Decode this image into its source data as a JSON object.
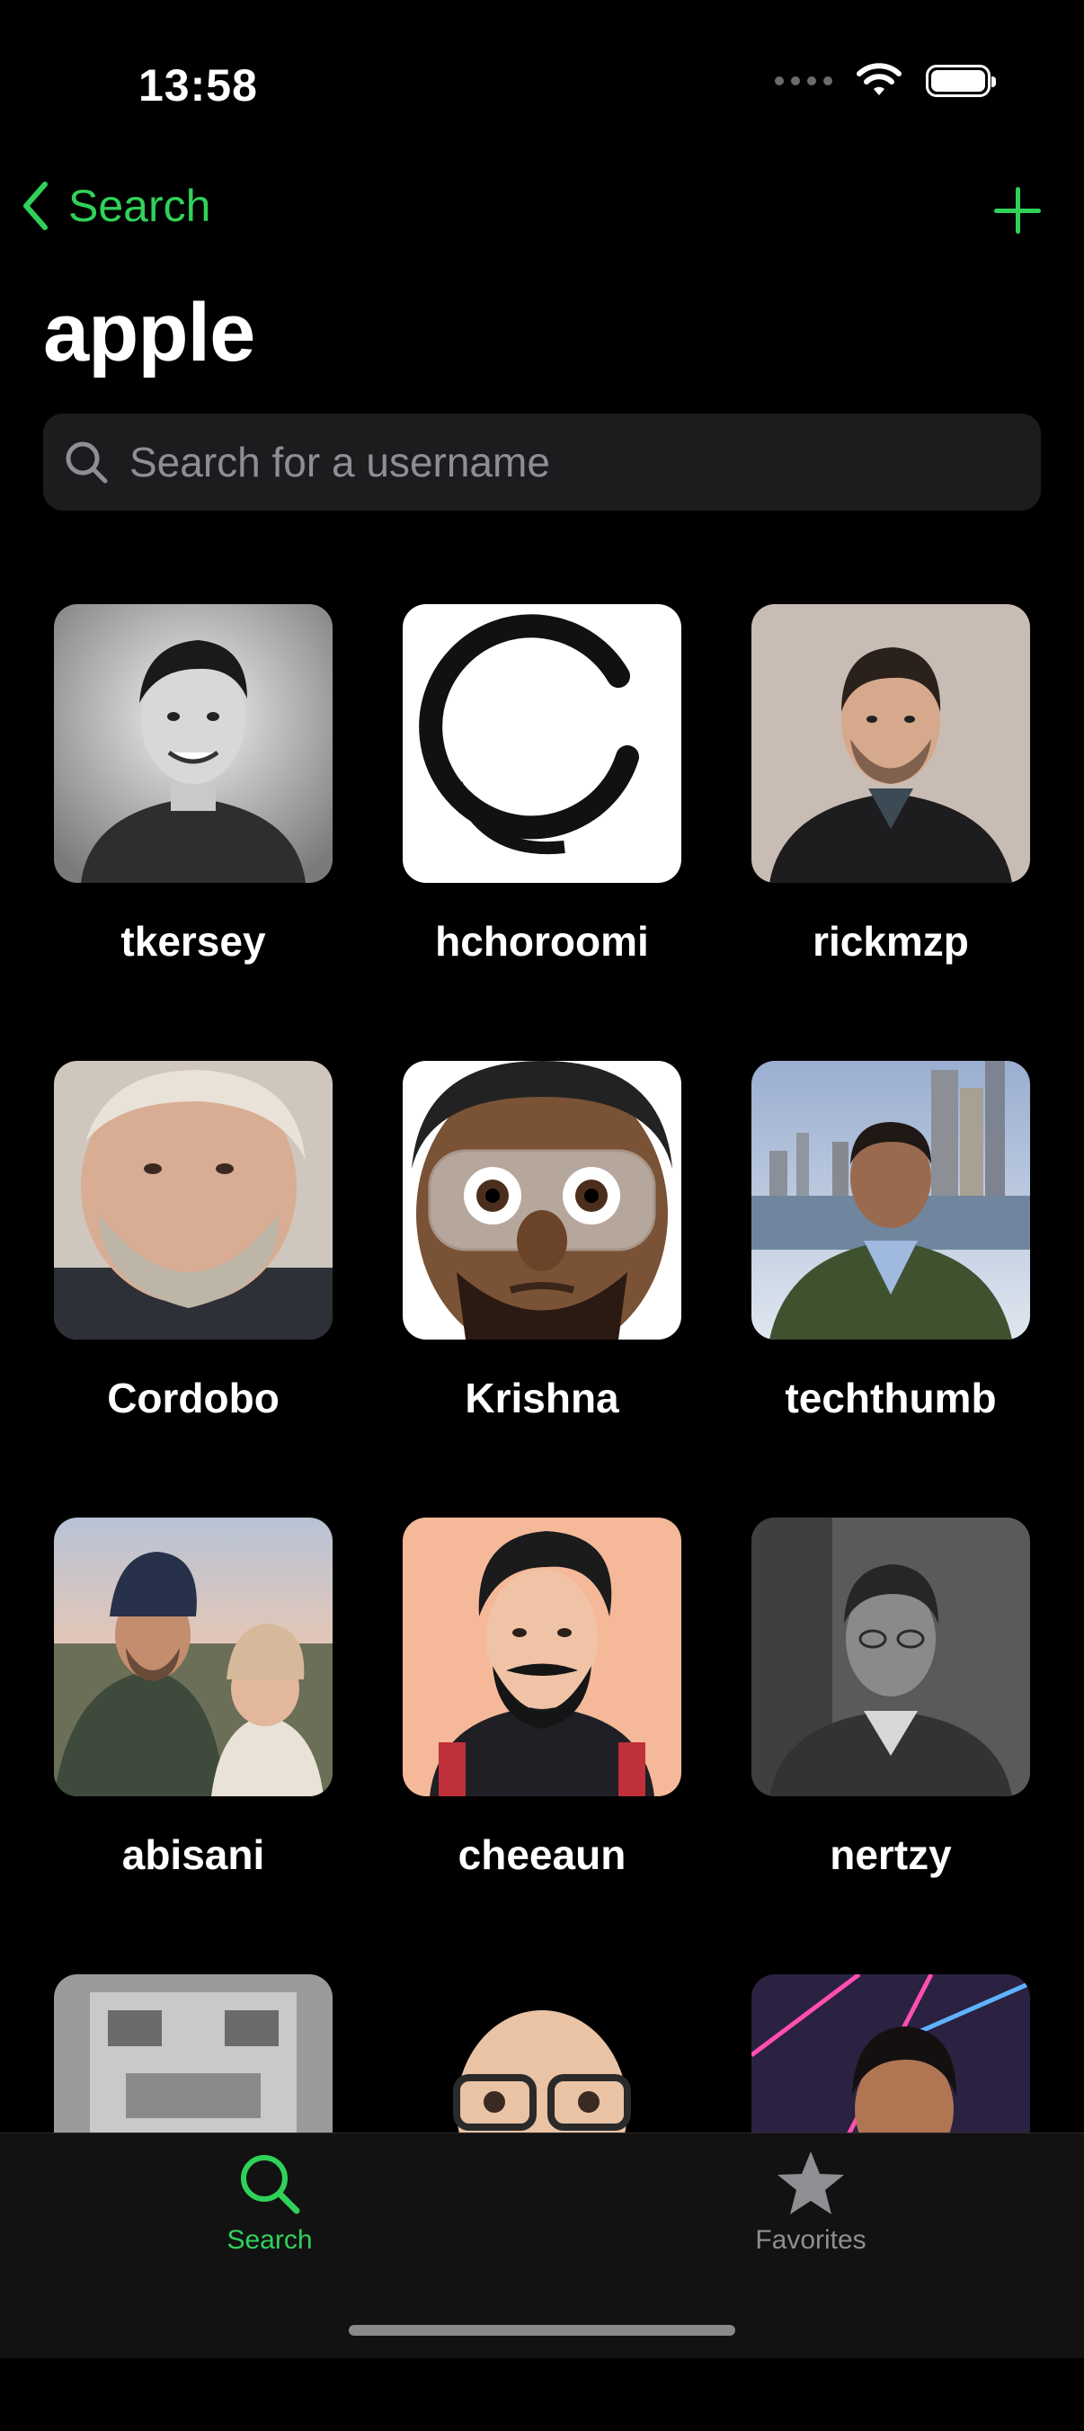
{
  "status": {
    "time": "13:58"
  },
  "nav": {
    "back_label": "Search"
  },
  "page": {
    "title": "apple"
  },
  "search": {
    "placeholder": "Search for a username"
  },
  "users": [
    {
      "username": "tkersey"
    },
    {
      "username": "hchoroomi"
    },
    {
      "username": "rickmzp"
    },
    {
      "username": "Cordobo"
    },
    {
      "username": "Krishna"
    },
    {
      "username": "techthumb"
    },
    {
      "username": "abisani"
    },
    {
      "username": "cheeaun"
    },
    {
      "username": "nertzy"
    },
    {
      "username": ""
    },
    {
      "username": ""
    },
    {
      "username": ""
    }
  ],
  "tabbar": {
    "tabs": [
      {
        "label": "Search",
        "icon": "search-icon",
        "active": true
      },
      {
        "label": "Favorites",
        "icon": "star-icon",
        "active": false
      }
    ]
  },
  "colors": {
    "accent": "#30d158",
    "background": "#000000",
    "inactive": "#8e8e93"
  }
}
